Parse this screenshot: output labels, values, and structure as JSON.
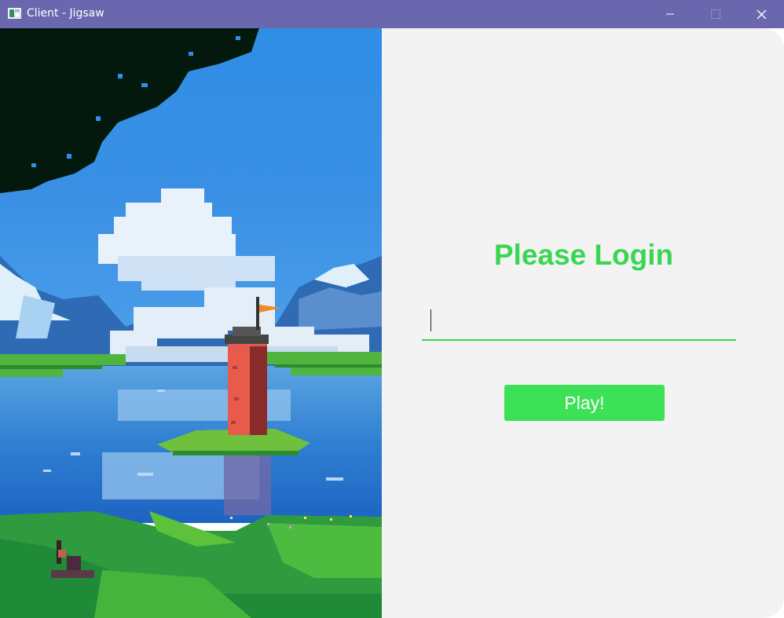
{
  "window": {
    "title": "Client - Jigsaw",
    "app_icon": "app-window-icon",
    "controls": [
      "minimize-icon",
      "maximize-icon",
      "close-icon"
    ],
    "titlebar_color": "#6a67ae"
  },
  "login": {
    "heading": "Please Login",
    "username_value": "",
    "play_label": "Play!",
    "accent_color": "#3ad653",
    "button_color": "#3ce156",
    "panel_color": "#f3f3f3"
  }
}
